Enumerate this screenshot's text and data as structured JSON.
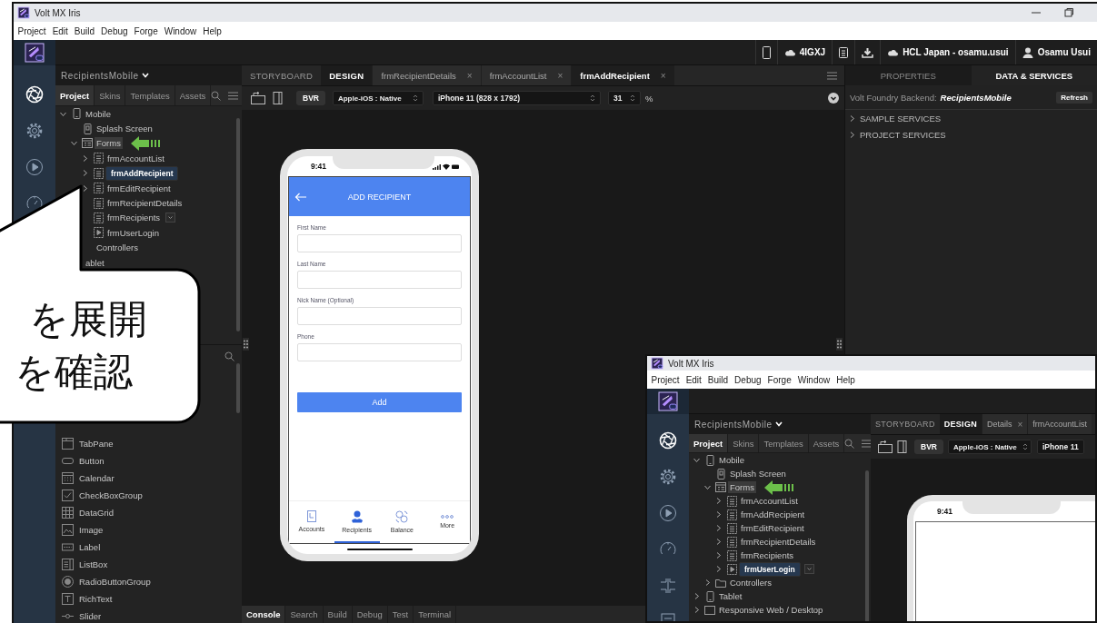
{
  "window": {
    "title": "Volt MX Iris"
  },
  "menu": [
    "Project",
    "Edit",
    "Build",
    "Debug",
    "Forge",
    "Window",
    "Help"
  ],
  "toolbar": {
    "app_id": "4IGXJ",
    "cloud_account": "HCL Japan - osamu.usui",
    "user": "Osamu Usui"
  },
  "project": {
    "name": "RecipientsMobile",
    "tabs": [
      {
        "label": "Project",
        "selected": true
      },
      {
        "label": "Skins",
        "selected": false
      },
      {
        "label": "Templates",
        "selected": false
      },
      {
        "label": "Assets",
        "selected": false
      }
    ],
    "tree": [
      {
        "label": "Mobile",
        "kind": "device",
        "expanded": true,
        "selected": false,
        "children": [
          {
            "label": "Splash Screen",
            "kind": "splash",
            "selected": false
          },
          {
            "label": "Forms",
            "kind": "forms",
            "expanded": true,
            "selected": false,
            "highlighted": true,
            "pointer": true,
            "children": [
              {
                "label": "frmAccountList",
                "kind": "form",
                "expanded": false,
                "selected": false
              },
              {
                "label": "frmAddRecipient",
                "kind": "form",
                "expanded": false,
                "selected": true
              },
              {
                "label": "frmEditRecipient",
                "kind": "form",
                "expanded": false,
                "selected": false
              },
              {
                "label": "frmRecipientDetails",
                "kind": "form",
                "selected": false
              },
              {
                "label": "frmRecipients",
                "kind": "form",
                "selected": false,
                "has_menu": true
              },
              {
                "label": "frmUserLogin",
                "kind": "form-run",
                "selected": false
              }
            ]
          },
          {
            "label": "Controllers",
            "selected": false
          }
        ]
      },
      {
        "label": "ablet",
        "selected": false
      }
    ]
  },
  "widgets": [
    {
      "label": "TabPane",
      "kind": "tabpane"
    },
    {
      "label": "Button",
      "kind": "button"
    },
    {
      "label": "Calendar",
      "kind": "calendar"
    },
    {
      "label": "CheckBoxGroup",
      "kind": "checkbox"
    },
    {
      "label": "DataGrid",
      "kind": "datagrid"
    },
    {
      "label": "Image",
      "kind": "image"
    },
    {
      "label": "Label",
      "kind": "label"
    },
    {
      "label": "ListBox",
      "kind": "listbox"
    },
    {
      "label": "RadioButtonGroup",
      "kind": "radio"
    },
    {
      "label": "RichText",
      "kind": "richtext"
    },
    {
      "label": "Slider",
      "kind": "slider"
    }
  ],
  "callout": {
    "lines": [
      "を展開",
      "を確認"
    ]
  },
  "editor": {
    "mode_tabs": [
      {
        "label": "STORYBOARD",
        "selected": false
      },
      {
        "label": "DESIGN",
        "selected": true
      }
    ],
    "file_tabs": [
      {
        "label": "frmRecipientDetails",
        "close": "×",
        "selected": false
      },
      {
        "label": "frmAccountList",
        "close": "×",
        "selected": false
      },
      {
        "label": "frmAddRecipient",
        "close": "×",
        "selected": true
      }
    ],
    "toolbar": {
      "badge": "BVR",
      "platform": "Apple-iOS : Native",
      "device": "iPhone 11 (828 x 1792)",
      "zoom": "31",
      "unit": "%"
    },
    "phone": {
      "time": "9:41",
      "title": "ADD RECIPIENT",
      "fields": [
        {
          "label": "First Name"
        },
        {
          "label": "Last Name"
        },
        {
          "label": "Nick Name (Optional)"
        },
        {
          "label": "Phone"
        }
      ],
      "button": "Add",
      "tabs": [
        {
          "label": "Accounts",
          "kind": "accounts",
          "selected": false
        },
        {
          "label": "Recipients",
          "kind": "recipients",
          "selected": true
        },
        {
          "label": "Balance",
          "kind": "balance",
          "selected": false
        },
        {
          "label": "More",
          "kind": "more",
          "selected": false
        }
      ]
    },
    "console_tabs": [
      {
        "label": "Console",
        "selected": true
      },
      {
        "label": "Search",
        "selected": false
      },
      {
        "label": "Build",
        "selected": false
      },
      {
        "label": "Debug",
        "selected": false
      },
      {
        "label": "Test",
        "selected": false
      },
      {
        "label": "Terminal",
        "selected": false
      }
    ]
  },
  "right_panel": {
    "tabs": [
      {
        "label": "PROPERTIES",
        "selected": false
      },
      {
        "label": "DATA & SERVICES",
        "selected": true
      }
    ],
    "backend_label": "Volt Foundry Backend:",
    "backend_name": "RecipientsMobile",
    "refresh": "Refresh",
    "services": [
      {
        "label": "SAMPLE SERVICES",
        "expanded": false
      },
      {
        "label": "PROJECT SERVICES",
        "expanded": false
      }
    ]
  },
  "inset": {
    "window": {
      "title": "Volt MX Iris"
    },
    "menu": [
      "Project",
      "Edit",
      "Build",
      "Debug",
      "Forge",
      "Window",
      "Help"
    ],
    "project": {
      "name": "RecipientsMobile",
      "tabs": [
        {
          "label": "Project",
          "selected": true
        },
        {
          "label": "Skins",
          "selected": false
        },
        {
          "label": "Templates",
          "selected": false
        },
        {
          "label": "Assets",
          "selected": false
        }
      ],
      "tree": [
        {
          "label": "Mobile",
          "kind": "device",
          "expanded": true,
          "selected": false,
          "children": [
            {
              "label": "Splash Screen",
              "kind": "splash",
              "selected": false
            },
            {
              "label": "Forms",
              "kind": "forms",
              "expanded": true,
              "selected": false,
              "highlighted": true,
              "pointer": true,
              "children": [
                {
                  "label": "frmAccountList",
                  "kind": "form",
                  "expanded": false,
                  "selected": false
                },
                {
                  "label": "frmAddRecipient",
                  "kind": "form",
                  "expanded": false,
                  "selected": false
                },
                {
                  "label": "frmEditRecipient",
                  "kind": "form",
                  "expanded": false,
                  "selected": false
                },
                {
                  "label": "frmRecipientDetails",
                  "kind": "form",
                  "expanded": false,
                  "selected": false
                },
                {
                  "label": "frmRecipients",
                  "kind": "form",
                  "expanded": false,
                  "selected": false
                },
                {
                  "label": "frmUserLogin",
                  "kind": "form-run",
                  "expanded": false,
                  "selected": true,
                  "has_menu": true
                }
              ]
            },
            {
              "label": "Controllers",
              "kind": "folder",
              "expanded": false,
              "selected": false
            }
          ]
        },
        {
          "label": "Tablet",
          "kind": "device",
          "expanded": false,
          "selected": false
        },
        {
          "label": "Responsive Web / Desktop",
          "kind": "desktop",
          "expanded": false,
          "selected": false
        }
      ]
    },
    "mode_tabs": [
      {
        "label": "STORYBOARD",
        "selected": false
      },
      {
        "label": "DESIGN",
        "selected": true
      }
    ],
    "file_tabs": [
      {
        "label": "Details",
        "close": "×",
        "selected": false
      },
      {
        "label": "frmAccountList",
        "selected": false
      }
    ],
    "toolbar": {
      "badge": "BVR",
      "platform": "Apple-iOS : Native",
      "device": "iPhone 11"
    },
    "phone": {
      "time": "9:41"
    }
  }
}
